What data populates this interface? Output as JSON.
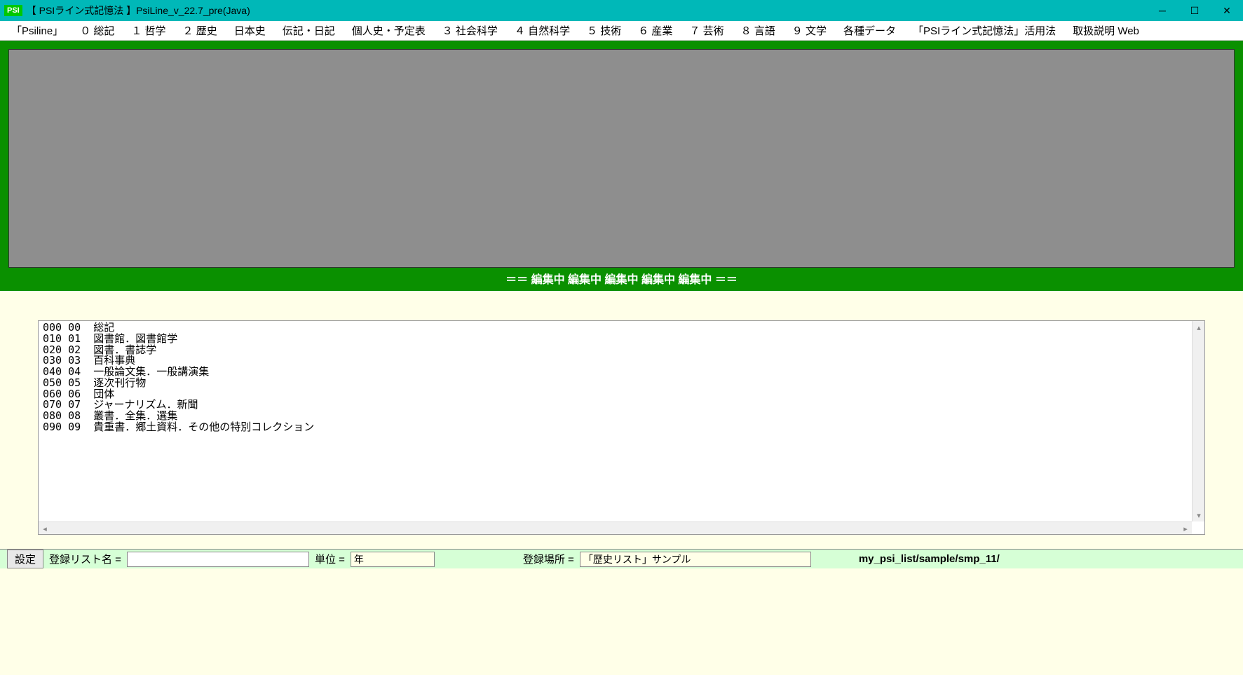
{
  "title": "【 PSIライン式記憶法 】PsiLine_v_22.7_pre(Java)",
  "app_badge": "PSI",
  "menu": [
    "「Psiline」",
    "０ 総記",
    "１ 哲学",
    "２ 歴史",
    "日本史",
    "伝記・日記",
    "個人史・予定表",
    "３ 社会科学",
    "４ 自然科学",
    "５ 技術",
    "６ 産業",
    "７ 芸術",
    "８ 言語",
    "９ 文学",
    "各種データ",
    "「PSIライン式記憶法」活用法",
    "取扱説明 Web"
  ],
  "editing_banner": "＝＝ 編集中 編集中 編集中 編集中 編集中 ＝＝",
  "editor_lines": [
    "000 00  総記",
    "010 01  図書館．図書館学",
    "020 02  図書．書誌学",
    "030 03  百科事典",
    "040 04  一般論文集．一般講演集",
    "050 05  逐次刊行物",
    "060 06  団体",
    "070 07  ジャーナリズム．新聞",
    "080 08  叢書．全集．選集",
    "090 09  貴重書．郷土資料．その他の特別コレクション"
  ],
  "bottom": {
    "settings": "設定",
    "list_name_label": "登録リスト名 =",
    "list_name_value": "",
    "unit_label": "単位 =",
    "unit_value": "年",
    "location_label": "登録場所 =",
    "location_value": "「歴史リスト」サンプル",
    "path": "my_psi_list/sample/smp_11/"
  }
}
